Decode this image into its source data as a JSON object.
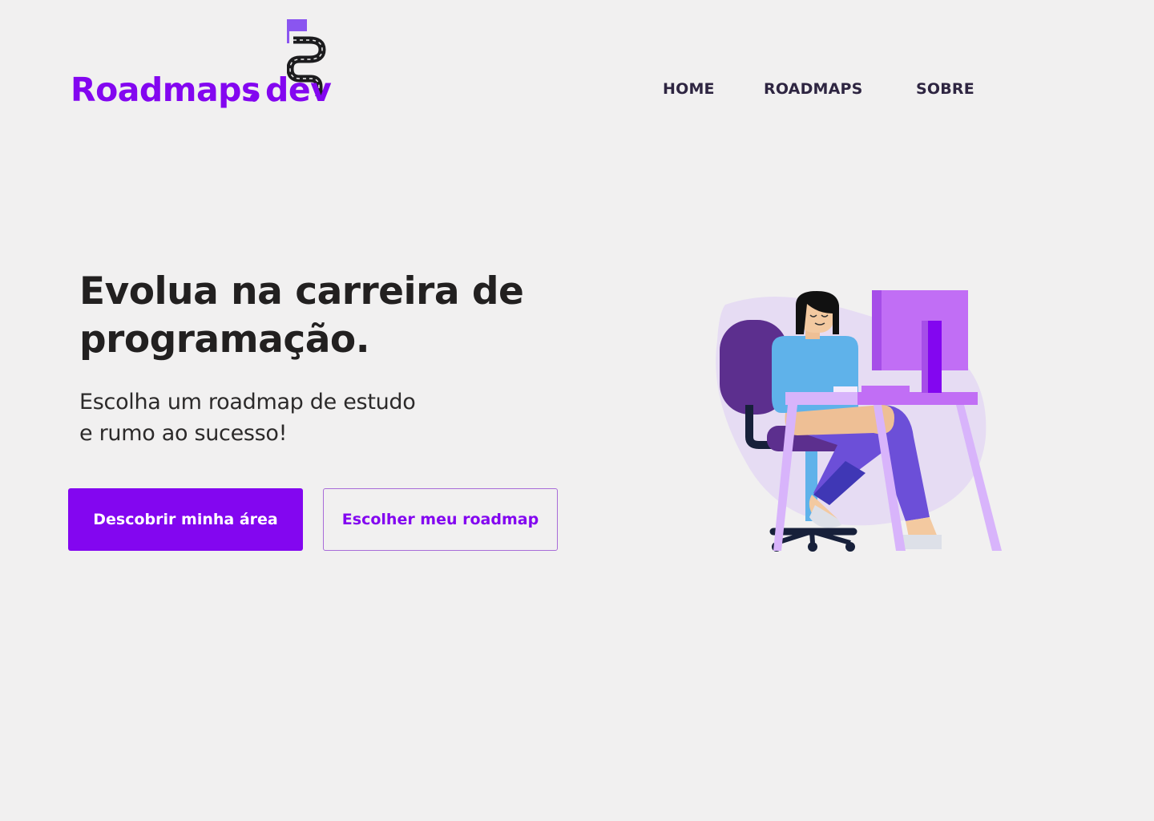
{
  "brand": {
    "name_left": "Roadmaps",
    "name_right": "dev",
    "color": "#8306f0"
  },
  "nav": {
    "items": [
      {
        "label": "HOME"
      },
      {
        "label": "ROADMAPS"
      },
      {
        "label": "SOBRE"
      }
    ]
  },
  "hero": {
    "title_line1": "Evolua na carreira de",
    "title_line2": "programação.",
    "subtitle_line1": "Escolha um roadmap de estudo",
    "subtitle_line2": "e rumo ao sucesso!",
    "primary_button": "Descobrir minha área",
    "secondary_button": "Escolher meu roadmap"
  },
  "icons": {
    "logo_mark": "winding-road-flag-icon",
    "illustration": "developer-at-desk-illustration"
  },
  "colors": {
    "accent": "#8306f0",
    "background": "#f1f0f0",
    "nav_text": "#2e2541",
    "heading_text": "#222020"
  }
}
